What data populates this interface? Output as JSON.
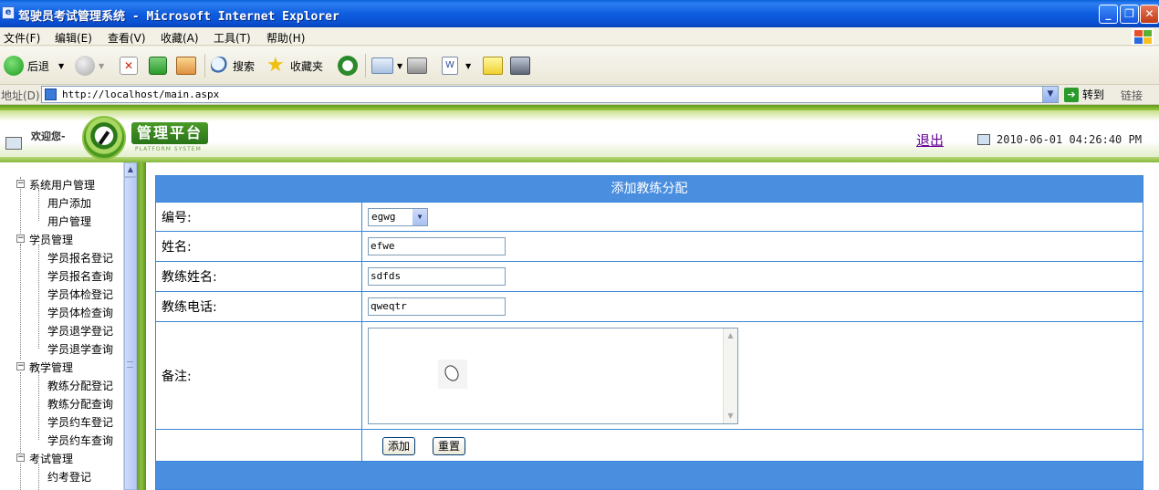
{
  "window": {
    "title": "驾驶员考试管理系统 - Microsoft Internet Explorer"
  },
  "menu": [
    "文件(F)",
    "编辑(E)",
    "查看(V)",
    "收藏(A)",
    "工具(T)",
    "帮助(H)"
  ],
  "toolbar": {
    "back": "后退",
    "search": "搜索",
    "favorites": "收藏夹"
  },
  "address": {
    "label": "地址(D)",
    "url": "http://localhost/main.aspx",
    "go": "转到",
    "links": "链接"
  },
  "header": {
    "welcome": "欢迎您-",
    "platform_title": "管理平台",
    "platform_sub": "PLATFORM SYSTEM",
    "logout": "退出",
    "datetime": "2010-06-01 04:26:40 PM"
  },
  "tree": [
    {
      "label": "系统用户管理",
      "children": [
        "用户添加",
        "用户管理"
      ]
    },
    {
      "label": "学员管理",
      "children": [
        "学员报名登记",
        "学员报名查询",
        "学员体检登记",
        "学员体检查询",
        "学员退学登记",
        "学员退学查询"
      ]
    },
    {
      "label": "教学管理",
      "children": [
        "教练分配登记",
        "教练分配查询",
        "学员约车登记",
        "学员约车查询"
      ]
    },
    {
      "label": "考试管理",
      "children": [
        "约考登记"
      ]
    }
  ],
  "form": {
    "title": "添加教练分配",
    "id_label": "编号:",
    "id_value": "egwg",
    "name_label": "姓名:",
    "name_value": "efwe",
    "coach_name_label": "教练姓名:",
    "coach_name_value": "sdfds",
    "coach_phone_label": "教练电话:",
    "coach_phone_value": "qweqtr",
    "remark_label": "备注:",
    "add_button": "添加",
    "reset_button": "重置"
  },
  "colors": {
    "title_bar": "#0a5fd8",
    "header_green": "#8cc040",
    "form_blue": "#4a8ee0",
    "logout_link": "#660099"
  }
}
